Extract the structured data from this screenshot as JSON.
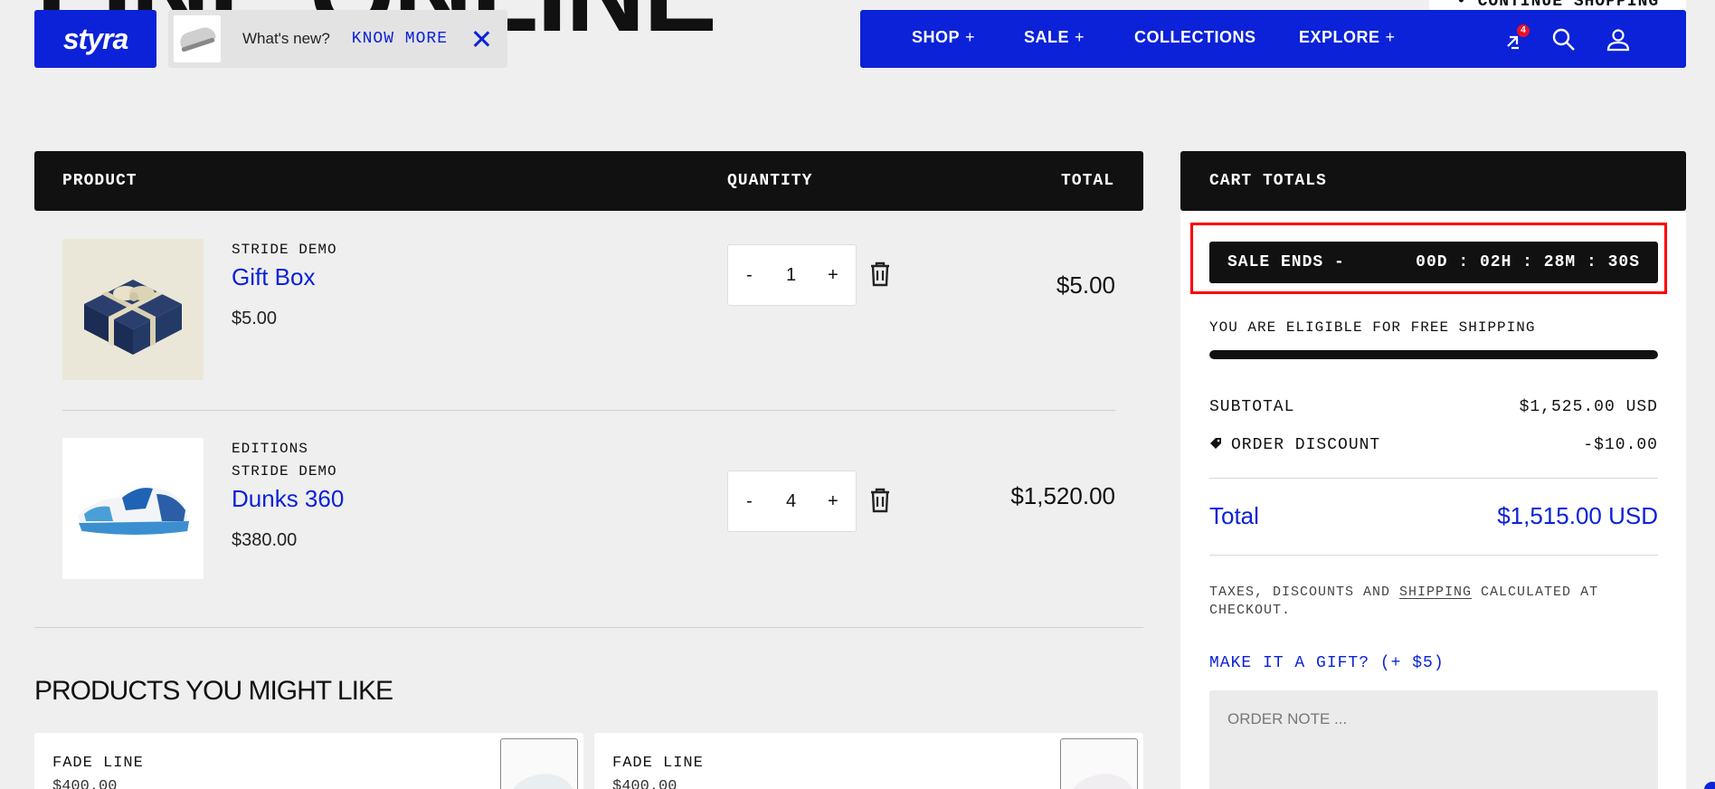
{
  "hero": {
    "text": "LINE ONLINE"
  },
  "continue_shopping": "• CONTINUE SHOPPING",
  "logo": {
    "text": "styra"
  },
  "whats_new": {
    "label": "What's new?",
    "link": "KNOW MORE"
  },
  "nav": {
    "items": [
      {
        "label": "SHOP",
        "suffix": "+"
      },
      {
        "label": "SALE",
        "suffix": "+"
      },
      {
        "label": "COLLECTIONS",
        "suffix": ""
      },
      {
        "label": "EXPLORE",
        "suffix": "+"
      }
    ],
    "compare_count": "4",
    "icons": [
      "compare-icon",
      "search-icon",
      "account-icon"
    ]
  },
  "cart": {
    "headers": {
      "product": "PRODUCT",
      "quantity": "QUANTITY",
      "total": "TOTAL"
    },
    "items": [
      {
        "vendor": [
          "STRIDE DEMO"
        ],
        "name": "Gift Box",
        "price": "$5.00",
        "qty": "1",
        "total": "$5.00"
      },
      {
        "vendor": [
          "EDITIONS",
          "STRIDE DEMO"
        ],
        "name": "Dunks 360",
        "price": "$380.00",
        "qty": "4",
        "total": "$1,520.00"
      }
    ],
    "minus": "-",
    "plus": "+"
  },
  "recommendations": {
    "title": "PRODUCTS YOU MIGHT LIKE",
    "cards": [
      {
        "title": "FADE LINE",
        "price": "$400.00"
      },
      {
        "title": "FADE LINE",
        "price": "$400.00"
      }
    ]
  },
  "totals": {
    "header": "CART TOTALS",
    "sale_label": "SALE ENDS -",
    "sale_timer": "00D : 02H : 28M : 30S",
    "eligible": "YOU ARE ELIGIBLE FOR FREE SHIPPING",
    "shipping_progress": 1.0,
    "subtotal_label": "SUBTOTAL",
    "subtotal_value": "$1,525.00 USD",
    "discount_label": "ORDER DISCOUNT",
    "discount_value": "-$10.00",
    "total_label": "Total",
    "total_value": "$1,515.00 USD",
    "taxes_pre": "TAXES, DISCOUNTS AND ",
    "taxes_link": "SHIPPING",
    "taxes_post": " CALCULATED AT CHECKOUT.",
    "gift": "MAKE IT A GIFT? (+ $5)",
    "note_placeholder": "ORDER NOTE ..."
  },
  "colors": {
    "brand": "#0b22d8",
    "dark": "#111111",
    "badge": "#e8102a",
    "highlight": "#ff0000"
  }
}
